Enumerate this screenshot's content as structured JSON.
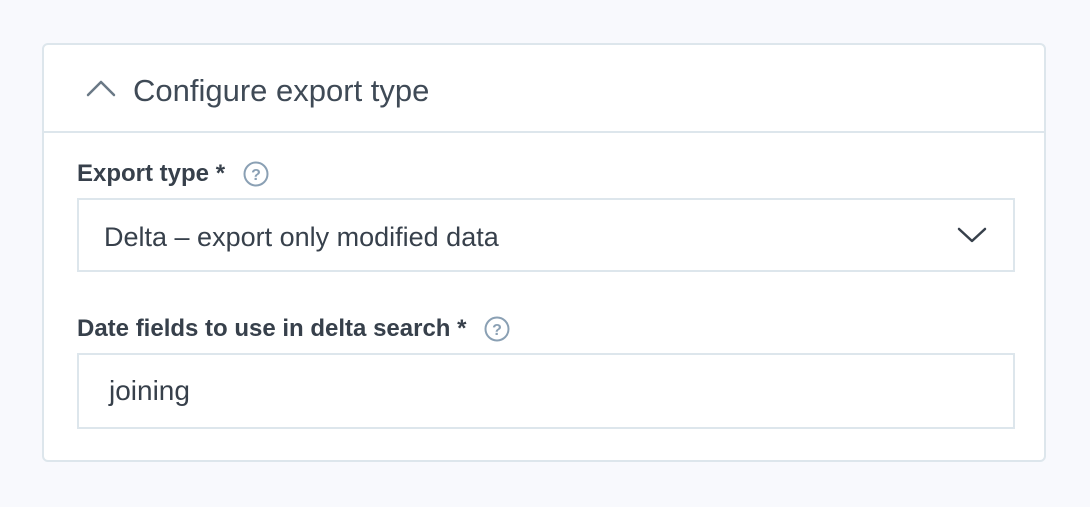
{
  "panel": {
    "title": "Configure export type",
    "toggle_icon": "chevron-up-icon"
  },
  "fields": {
    "export_type": {
      "label": "Export type *",
      "help_icon": "question-circle-icon",
      "value": "Delta – export only modified data",
      "dropdown_icon": "chevron-down-icon"
    },
    "date_fields": {
      "label": "Date fields to use in delta search *",
      "help_icon": "question-circle-icon",
      "value": "joining"
    }
  },
  "colors": {
    "background": "#f8f9fd",
    "border": "#dde6ec",
    "text": "#37404b",
    "icon": "#8aa0b4"
  }
}
